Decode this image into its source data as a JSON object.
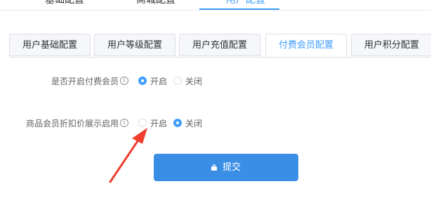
{
  "top_tabs": [
    {
      "label": "基础配置"
    },
    {
      "label": "商城配置"
    },
    {
      "label": "用户配置"
    }
  ],
  "card_tabs": [
    {
      "label": "用户基础配置"
    },
    {
      "label": "用户等级配置"
    },
    {
      "label": "用户充值配置"
    },
    {
      "label": "付费会员配置"
    },
    {
      "label": "用户积分配置"
    }
  ],
  "form": {
    "paid_member": {
      "label": "是否开启付费会员",
      "options": [
        "开启",
        "关闭"
      ],
      "selected": "开启"
    },
    "discount_display": {
      "label": "商品会员折扣价展示启用",
      "options": [
        "开启",
        "关闭"
      ],
      "selected": "关闭"
    }
  },
  "submit": {
    "label": "提交"
  },
  "colors": {
    "accent": "#409eff",
    "button": "#3a8ee6",
    "arrow": "#f03e2f"
  }
}
